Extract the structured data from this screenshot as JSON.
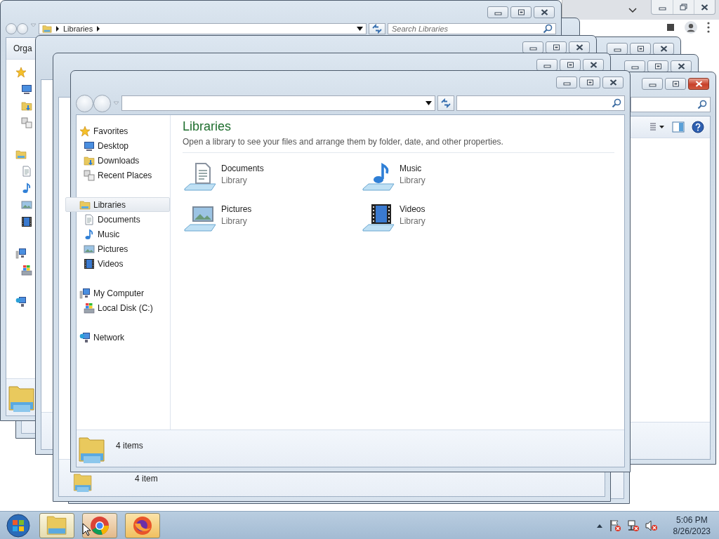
{
  "windows": [
    {
      "kind": "browser"
    },
    {
      "kind": "explorer"
    },
    {
      "kind": "explorer",
      "active": false,
      "address": {
        "crumbs": [
          "Libraries"
        ]
      },
      "search": {
        "placeholder": "Search Libraries"
      },
      "toolbar": {
        "label": "Orga"
      }
    },
    {
      "kind": "explorer",
      "active": false
    },
    {
      "kind": "explorer",
      "active": false
    },
    {
      "kind": "explorer",
      "active": false
    },
    {
      "kind": "explorer",
      "active": true
    },
    {
      "kind": "explorer"
    },
    {
      "kind": "explorer",
      "active": false,
      "status": "4 item"
    },
    {
      "kind": "explorer",
      "active": false,
      "sidebar": [
        {
          "label": "Favorites",
          "selected": false,
          "children": [
            {
              "label": "Desktop",
              "selected": false
            },
            {
              "label": "Downloads",
              "selected": false
            },
            {
              "label": "Recent Places",
              "selected": false
            }
          ]
        },
        {
          "label": "Libraries",
          "selected": true,
          "children": [
            {
              "label": "Documents",
              "selected": false
            },
            {
              "label": "Music",
              "selected": false
            },
            {
              "label": "Pictures",
              "selected": false
            },
            {
              "label": "Videos",
              "selected": false
            }
          ]
        },
        {
          "label": "My Computer",
          "selected": false,
          "children": [
            {
              "label": "Local Disk (C:)",
              "selected": false
            }
          ]
        },
        {
          "label": "Network",
          "selected": false
        }
      ],
      "content": {
        "heading": "Libraries",
        "description": "Open a library to see your files and arrange them by folder, date, and other properties.",
        "items": [
          {
            "name": "Documents",
            "type": "Library",
            "selected": false
          },
          {
            "name": "Music",
            "type": "Library",
            "selected": false
          },
          {
            "name": "Pictures",
            "type": "Library",
            "selected": false
          },
          {
            "name": "Videos",
            "type": "Library",
            "selected": false
          }
        ]
      },
      "status": "4 items"
    }
  ],
  "taskbar": {
    "clock": {
      "time": "5:06 PM",
      "date": "8/26/2023"
    }
  }
}
